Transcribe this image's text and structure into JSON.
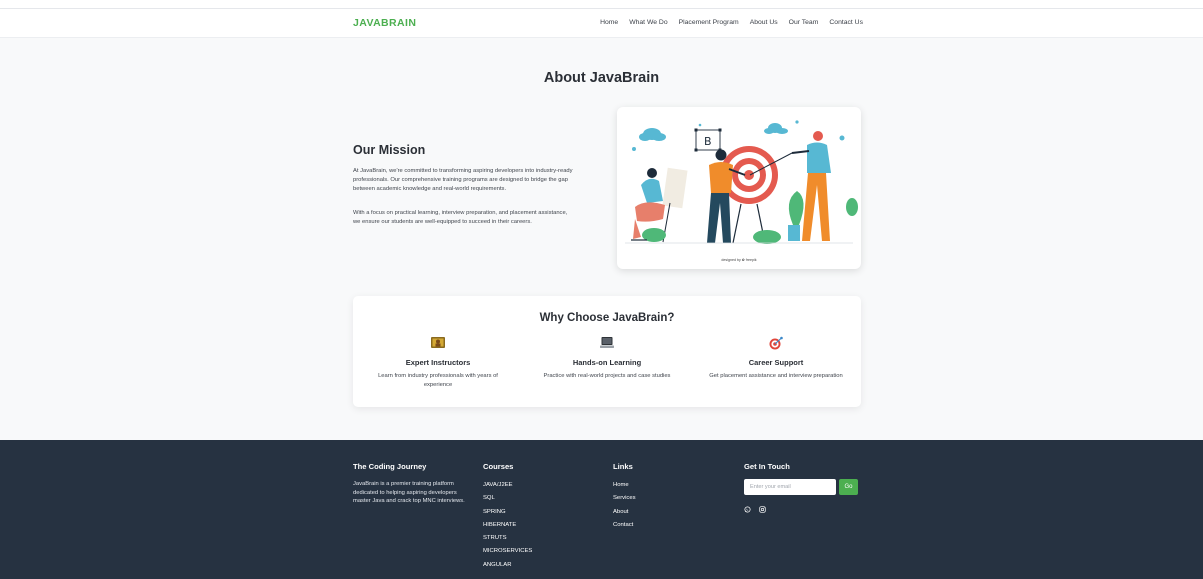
{
  "nav": {
    "brand": "JAVABRAIN",
    "links": [
      "Home",
      "What We Do",
      "Placement Program",
      "About Us",
      "Our Team",
      "Contact Us"
    ]
  },
  "page_title": "About JavaBrain",
  "mission": {
    "title": "Our Mission",
    "p1": "At JavaBrain, we're committed to transforming aspiring developers into industry-ready professionals. Our comprehensive training programs are designed to bridge the gap between academic knowledge and real-world requirements.",
    "p2": "With a focus on practical learning, interview preparation, and placement assistance, we ensure our students are well-equipped to succeed in their careers.",
    "illustration_credit": "designed by ✿ freepik"
  },
  "why": {
    "title": "Why Choose JavaBrain?",
    "features": [
      {
        "icon": "teacher-icon",
        "title": "Expert Instructors",
        "text": "Learn from industry professionals with years of experience"
      },
      {
        "icon": "laptop-icon",
        "title": "Hands-on Learning",
        "text": "Practice with real-world projects and case studies"
      },
      {
        "icon": "target-icon",
        "title": "Career Support",
        "text": "Get placement assistance and interview preparation"
      }
    ]
  },
  "footer": {
    "about": {
      "title": "The Coding Journey",
      "text": "JavaBrain is a premier training platform dedicated to helping aspiring developers master Java and crack top MNC interviews."
    },
    "courses": {
      "title": "Courses",
      "items": [
        "JAVA/J2EE",
        "SQL",
        "SPRING",
        "HIBERNATE",
        "STRUTS",
        "MICROSERVICES",
        "ANGULAR"
      ]
    },
    "links": {
      "title": "Links",
      "items": [
        "Home",
        "Services",
        "About",
        "Contact"
      ]
    },
    "contact": {
      "title": "Get In Touch",
      "placeholder": "Enter your email",
      "button": "Go",
      "social": [
        "whatsapp-icon",
        "instagram-icon"
      ]
    }
  },
  "colors": {
    "accent": "#4caf50",
    "footer_bg": "#263241",
    "page_bg": "#f8f9fa"
  }
}
